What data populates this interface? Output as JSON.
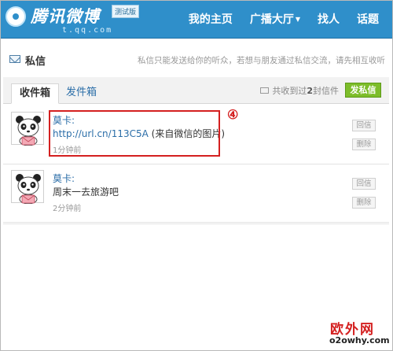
{
  "header": {
    "logo_text": "腾讯微博",
    "beta_badge": "测试版",
    "logo_domain": "t.qq.com",
    "brand_color": "#2f8fca",
    "nav": [
      {
        "label": "我的主页"
      },
      {
        "label": "广播大厅",
        "has_dropdown": true
      },
      {
        "label": "找人"
      },
      {
        "label": "话题"
      }
    ]
  },
  "page": {
    "title": "私信",
    "title_icon": "mail-icon",
    "note": "私信只能发送给你的听众，若想与朋友通过私信交流，请先相互收听"
  },
  "tabs": {
    "items": [
      {
        "label": "收件箱",
        "active": true
      },
      {
        "label": "发件箱",
        "active": false
      }
    ],
    "received_prefix": "共收到过",
    "received_count": "2",
    "received_suffix": "封信件",
    "compose_label": "发私信",
    "compose_color": "#7dbd2a"
  },
  "messages": [
    {
      "sender": "莫卡:",
      "link": "http://url.cn/113C5A",
      "text": " (来自微信的图片)",
      "time": "1分钟前",
      "reply_label": "回信",
      "delete_label": "删除",
      "highlighted": true
    },
    {
      "sender": "莫卡:",
      "link": "",
      "text": "周末一去旅游吧",
      "time": "2分钟前",
      "reply_label": "回信",
      "delete_label": "删除",
      "highlighted": false
    }
  ],
  "annotation": {
    "step": "④",
    "color": "#d42020"
  },
  "watermark": {
    "name": "欧外网",
    "url": "o2owhy.com"
  }
}
